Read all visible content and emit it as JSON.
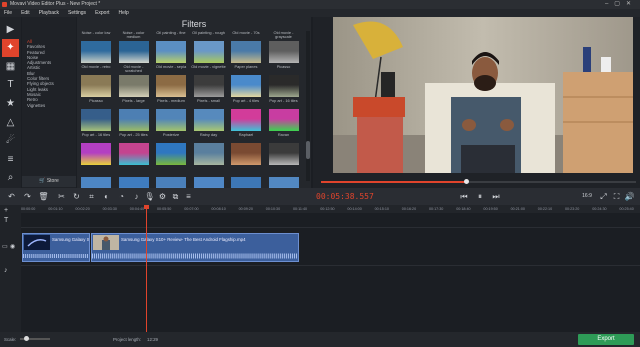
{
  "window": {
    "title": "Movavi Video Editor Plus - New Project *"
  },
  "menu": [
    "File",
    "Edit",
    "Playback",
    "Settings",
    "Export",
    "Help"
  ],
  "tools": [
    {
      "name": "import-icon",
      "glyph": "▶"
    },
    {
      "name": "filters-icon",
      "glyph": "✦"
    },
    {
      "name": "clapper-icon",
      "glyph": "▦"
    },
    {
      "name": "titles-icon",
      "glyph": "T"
    },
    {
      "name": "stickers-icon",
      "glyph": "★"
    },
    {
      "name": "shapes-icon",
      "glyph": "△"
    },
    {
      "name": "motion-icon",
      "glyph": "☄"
    },
    {
      "name": "more-tools-icon",
      "glyph": "≡"
    },
    {
      "name": "zoom-icon",
      "glyph": "⌕"
    }
  ],
  "categories": {
    "items": [
      "All",
      "Favorites",
      "Featured",
      "Noise",
      "Adjustments",
      "Artistic",
      "Blur",
      "Color filters",
      "Flying objects",
      "Light leaks",
      "Mosaic",
      "Retro",
      "Vignettes"
    ],
    "selected_index": 0,
    "store_label": "Store"
  },
  "filters": {
    "title": "Filters",
    "tiles": [
      {
        "label": "Noise - color low",
        "c1": "#2f6b9e",
        "c2": "#c9cfc6"
      },
      {
        "label": "Noise - color medium",
        "c1": "#2b6495",
        "c2": "#d2d5cc"
      },
      {
        "label": "Oil painting - fine",
        "c1": "#5b8fc3",
        "c2": "#b8d06a"
      },
      {
        "label": "Oil painting - rough",
        "c1": "#6a98c7",
        "c2": "#a9c95e"
      },
      {
        "label": "Old movie - 70s",
        "c1": "#4a7aa8",
        "c2": "#c4b98a"
      },
      {
        "label": "Old movie - grayscale",
        "c1": "#5e5e5e",
        "c2": "#b4b4b4"
      },
      {
        "label": "Old movie - retro",
        "c1": "#8a7a56",
        "c2": "#d9cfa2"
      },
      {
        "label": "Old movie - scratched",
        "c1": "#7a7a6a",
        "c2": "#d4d0b8"
      },
      {
        "label": "Old movie - sepia",
        "c1": "#8c6b44",
        "c2": "#d9bf92"
      },
      {
        "label": "Old movie - vignette",
        "c1": "#3c3c3c",
        "c2": "#9c9c9c"
      },
      {
        "label": "Paper planes",
        "c1": "#4a8acb",
        "c2": "#e2d7a0"
      },
      {
        "label": "Picasso",
        "c1": "#2a2a2a",
        "c2": "#9ea88e"
      },
      {
        "label": "Picasso",
        "c1": "#365e8a",
        "c2": "#a7c27a"
      },
      {
        "label": "Pixels - large",
        "c1": "#4d7fb3",
        "c2": "#9cbc66"
      },
      {
        "label": "Pixels - medium",
        "c1": "#5285b8",
        "c2": "#a3c46c"
      },
      {
        "label": "Pixels - small",
        "c1": "#578abd",
        "c2": "#a9c872"
      },
      {
        "label": "Pop art - 4 tiles",
        "c1": "#d23c9a",
        "c2": "#3ec4d8"
      },
      {
        "label": "Pop art - 16 tiles",
        "c1": "#c83da1",
        "c2": "#3bd44e"
      },
      {
        "label": "Pop art - 16 tiles",
        "c1": "#b33fc2",
        "c2": "#e8d23a"
      },
      {
        "label": "Pop art - 25 tiles",
        "c1": "#c4448f",
        "c2": "#39c0d1"
      },
      {
        "label": "Posterize",
        "c1": "#2f77c0",
        "c2": "#7ab83c"
      },
      {
        "label": "Rainy day",
        "c1": "#5a7f9e",
        "c2": "#a7b6a0"
      },
      {
        "label": "Raphael",
        "c1": "#7a4a32",
        "c2": "#d19a6c"
      },
      {
        "label": "Ravan",
        "c1": "#3b3b3b",
        "c2": "#b8b8b8"
      },
      {
        "label": "",
        "c1": "#4d86c4",
        "c2": "#93b6d8"
      },
      {
        "label": "",
        "c1": "#3f7cbf",
        "c2": "#9cc2e2"
      },
      {
        "label": "",
        "c1": "#4a80bb",
        "c2": "#b5cbe0"
      },
      {
        "label": "",
        "c1": "#4f87c6",
        "c2": "#a6c4e2"
      },
      {
        "label": "",
        "c1": "#3d77b6",
        "c2": "#8fb3d8"
      },
      {
        "label": "",
        "c1": "#5288c2",
        "c2": "#b0cce6"
      }
    ]
  },
  "player": {
    "timecode": "00:05:38.557",
    "progress_fraction": 0.46,
    "aspect_label": "16:9"
  },
  "toolbar": {
    "left": [
      "undo-icon",
      "redo-icon",
      "delete-icon",
      "cut-icon",
      "rotate-icon",
      "crop-icon",
      "color-icon",
      "speed-icon",
      "audio-icon",
      "record-icon",
      "settings-icon",
      "transition-icon",
      "equalizer-icon"
    ],
    "left_glyphs": [
      "↶",
      "↷",
      "🗑",
      "✂",
      "↻",
      "⌗",
      "◐",
      "◔",
      "♪",
      "🎙",
      "⚙",
      "⧉",
      "≡"
    ],
    "transport": [
      "⏮",
      "⏸",
      "⏭"
    ],
    "right_glyphs": [
      "⤢",
      "⛶",
      "🔊"
    ]
  },
  "ruler": {
    "ticks": [
      "00:00:00",
      "00:01:10",
      "00:02:20",
      "00:03:30",
      "00:04:40",
      "00:05:50",
      "00:07:00",
      "00:08:10",
      "00:09:20",
      "00:10:30",
      "00:11:40",
      "00:12:50",
      "00:14:00",
      "00:15:10",
      "00:16:20",
      "00:17:30",
      "00:18:40",
      "00:19:50",
      "00:21:00",
      "00:22:10",
      "00:23:20",
      "00:24:30",
      "00:25:40"
    ]
  },
  "clips": [
    {
      "title": "Samsung Galaxy S"
    },
    {
      "title": "Samsung Galaxy S10+ Review- The Best Android Flagship.mp4"
    }
  ],
  "status": {
    "scale_label": "Scale:",
    "project_length_label": "Project length:",
    "project_length": "12:29",
    "export_label": "Export"
  }
}
